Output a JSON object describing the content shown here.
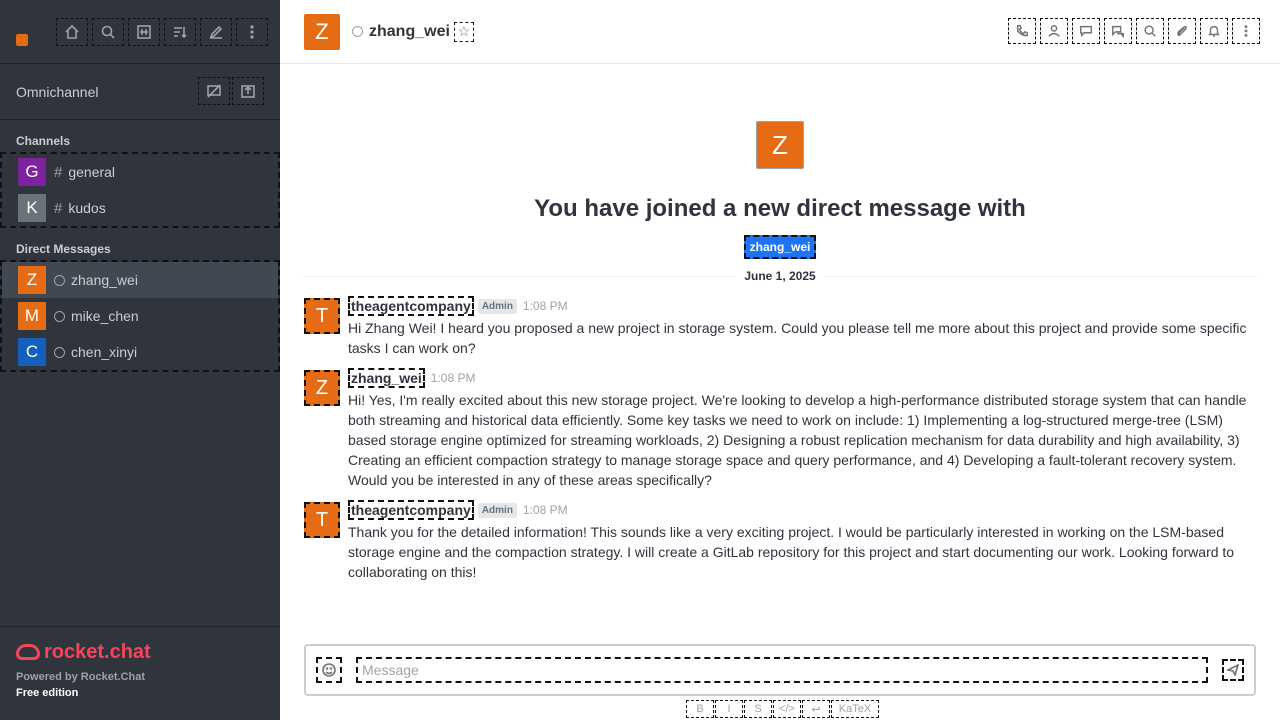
{
  "sidebar": {
    "omnichannel_label": "Omnichannel",
    "channels_title": "Channels",
    "dm_title": "Direct Messages",
    "channels": [
      {
        "initial": "G",
        "name": "general",
        "color": "#7e22a0"
      },
      {
        "initial": "K",
        "name": "kudos",
        "color": "#6c727a"
      }
    ],
    "dms": [
      {
        "initial": "Z",
        "name": "zhang_wei",
        "color": "#e56b15"
      },
      {
        "initial": "M",
        "name": "mike_chen",
        "color": "#e56b15"
      },
      {
        "initial": "C",
        "name": "chen_xinyi",
        "color": "#1560bd"
      }
    ],
    "powered_by": "Powered by Rocket.Chat",
    "edition": "Free edition",
    "logo_text": "rocket.chat"
  },
  "header": {
    "avatar_initial": "Z",
    "room_name": "zhang_wei",
    "star": "☆"
  },
  "welcome": {
    "avatar_initial": "Z",
    "title": "You have joined a new direct message with",
    "mention": "zhang_wei"
  },
  "date_divider": "June 1, 2025",
  "messages": [
    {
      "initial": "T",
      "user": "theagentcompany",
      "role": "Admin",
      "time": "1:08 PM",
      "text": "Hi Zhang Wei! I heard you proposed a new project in storage system. Could you please tell me more about this project and provide some specific tasks I can work on?"
    },
    {
      "initial": "Z",
      "user": "zhang_wei",
      "role": "",
      "time": "1:08 PM",
      "text": "Hi! Yes, I'm really excited about this new storage project. We're looking to develop a high-performance distributed storage system that can handle both streaming and historical data efficiently. Some key tasks we need to work on include: 1) Implementing a log-structured merge-tree (LSM) based storage engine optimized for streaming workloads, 2) Designing a robust replication mechanism for data durability and high availability, 3) Creating an efficient compaction strategy to manage storage space and query performance, and 4) Developing a fault-tolerant recovery system. Would you be interested in any of these areas specifically?"
    },
    {
      "initial": "T",
      "user": "theagentcompany",
      "role": "Admin",
      "time": "1:08 PM",
      "text": "Thank you for the detailed information! This sounds like a very exciting project. I would be particularly interested in working on the LSM-based storage engine and the compaction strategy. I will create a GitLab repository for this project and start documenting our work. Looking forward to collaborating on this!"
    }
  ],
  "composer": {
    "placeholder": "Message"
  },
  "format_bar": [
    "B",
    "I",
    "S",
    "</>",
    "↩",
    "KaTeX"
  ],
  "colors": {
    "sidebar_bg": "#2f343d",
    "accent_orange": "#e56b15",
    "mention_blue": "#1d74f5",
    "brand_red": "#f5455c"
  }
}
